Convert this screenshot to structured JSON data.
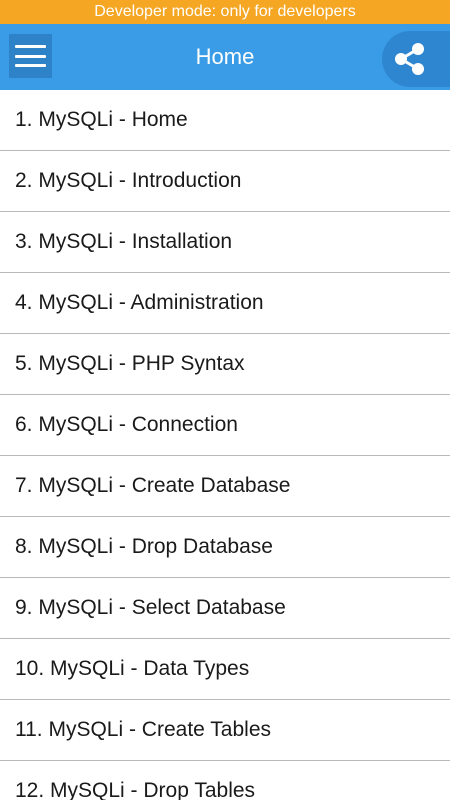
{
  "banner": {
    "text": "Developer mode: only for developers",
    "color": "#f5a623"
  },
  "app_bar": {
    "title": "Home",
    "color": "#3a9ce6",
    "menu_icon": "hamburger-menu-icon",
    "share_icon": "share-icon"
  },
  "topics": [
    {
      "label": "1. MySQLi - Home"
    },
    {
      "label": "2. MySQLi - Introduction"
    },
    {
      "label": "3. MySQLi - Installation"
    },
    {
      "label": "4. MySQLi - Administration"
    },
    {
      "label": "5. MySQLi - PHP Syntax"
    },
    {
      "label": "6. MySQLi - Connection"
    },
    {
      "label": "7. MySQLi - Create Database"
    },
    {
      "label": "8. MySQLi - Drop Database"
    },
    {
      "label": "9. MySQLi - Select Database"
    },
    {
      "label": "10. MySQLi - Data Types"
    },
    {
      "label": "11. MySQLi - Create Tables"
    },
    {
      "label": "12. MySQLi - Drop Tables"
    }
  ]
}
